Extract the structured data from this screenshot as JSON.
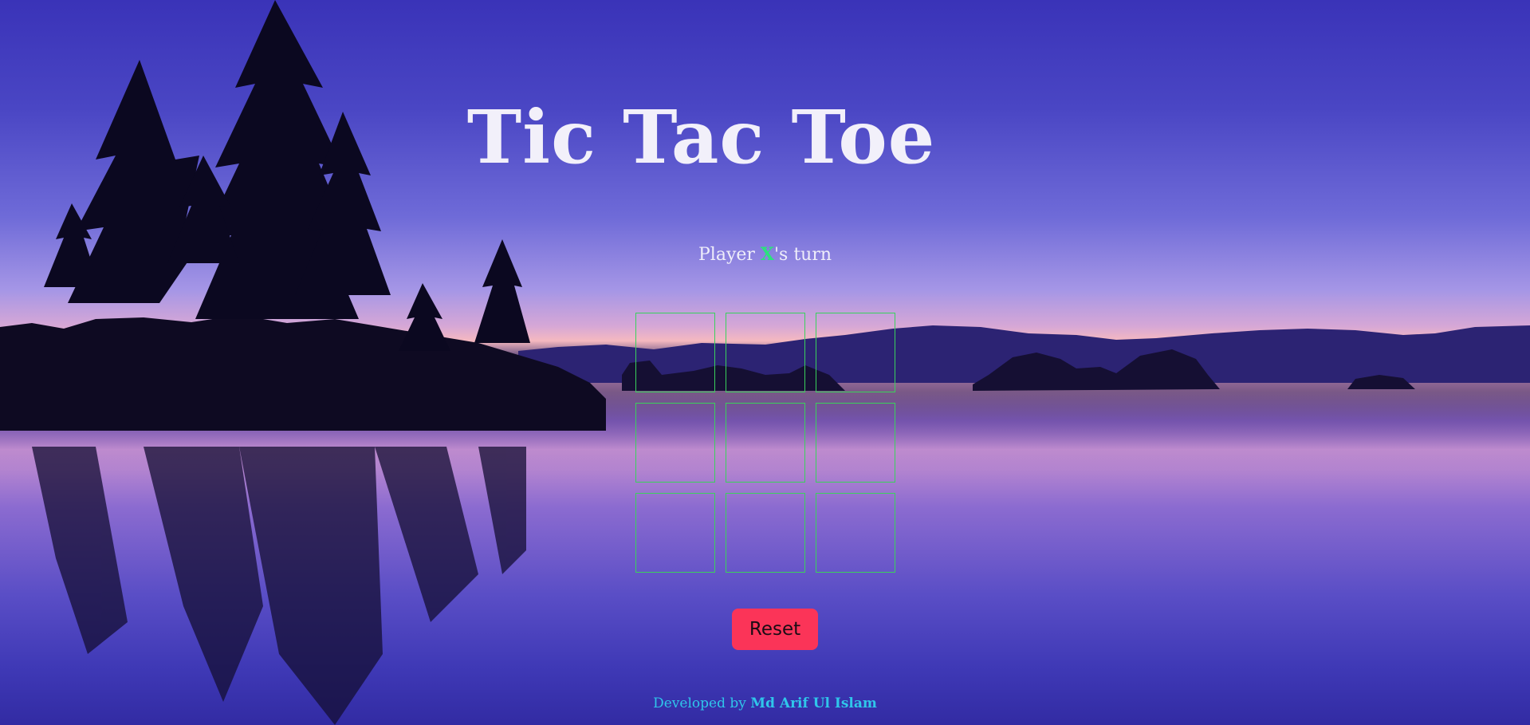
{
  "game": {
    "title": "Tic Tac Toe",
    "turn_prefix": "Player ",
    "current_player": "X",
    "turn_suffix": "'s turn",
    "board": [
      "",
      "",
      "",
      "",
      "",
      "",
      "",
      "",
      ""
    ],
    "reset_label": "Reset"
  },
  "footer": {
    "prefix": "Developed by ",
    "author": "Md Arif Ul Islam"
  },
  "colors": {
    "cell_border": "#3ad15c",
    "current_player": "#2be27d",
    "reset_button": "#fb3458",
    "footer_text": "#2fc6ea"
  }
}
